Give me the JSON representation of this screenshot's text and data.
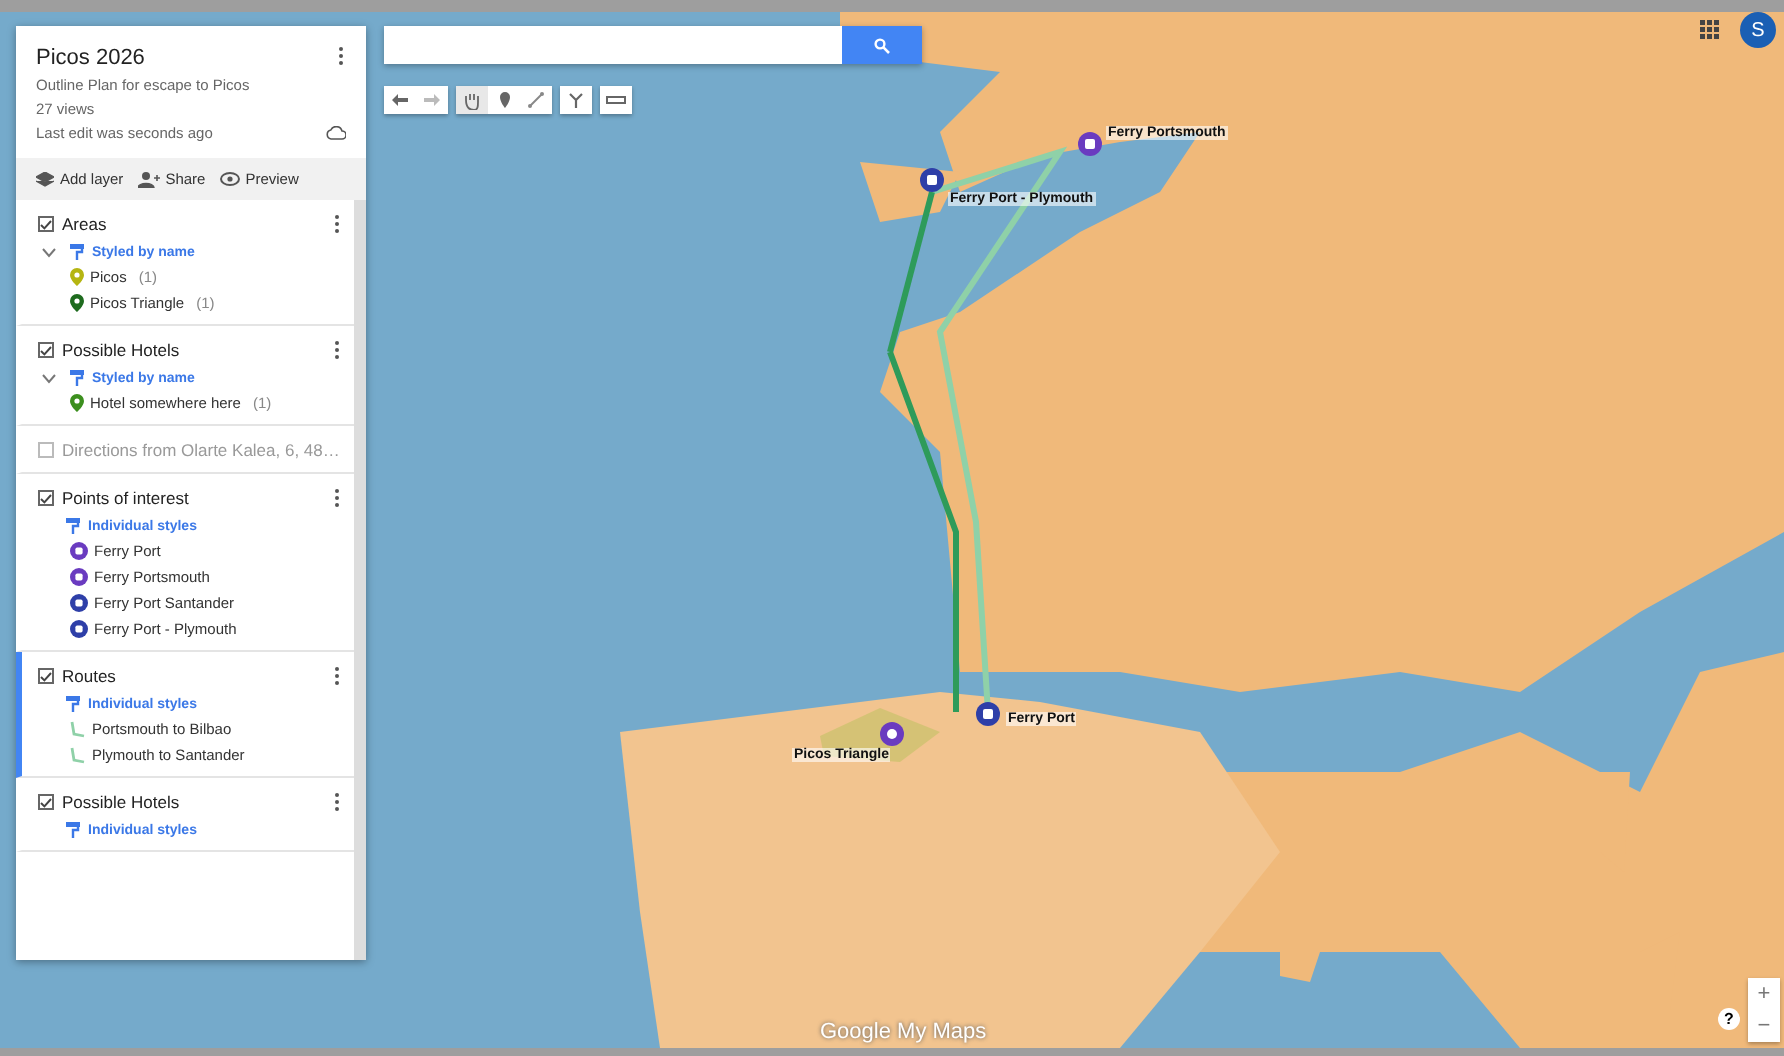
{
  "map_panel": {
    "title": "Picos 2026",
    "description": "Outline Plan for escape to Picos",
    "views": "27 views",
    "last_edit": "Last edit was seconds ago",
    "actions": [
      {
        "kind": "layer",
        "label": "Add layer"
      },
      {
        "kind": "share",
        "label": "Share"
      },
      {
        "kind": "preview",
        "label": "Preview"
      }
    ],
    "layers": [
      {
        "name": "Areas",
        "checked": true,
        "selected": false,
        "style": "Styled by name",
        "collapsible": true,
        "items": [
          {
            "name": "Picos",
            "count": "(1)",
            "kind": "pin",
            "color": "#b5b512"
          },
          {
            "name": "Picos Triangle",
            "count": "(1)",
            "kind": "pin",
            "color": "#1e6b1e"
          }
        ]
      },
      {
        "name": "Possible Hotels",
        "checked": true,
        "selected": false,
        "style": "Styled by name",
        "collapsible": true,
        "items": [
          {
            "name": "Hotel somewhere here",
            "count": "(1)",
            "kind": "pin",
            "color": "#3c8f1e"
          }
        ]
      },
      {
        "name": "Directions from Olarte Kalea, 6, 48…",
        "checked": false,
        "selected": false
      },
      {
        "name": "Points of interest",
        "checked": true,
        "selected": false,
        "style": "Individual styles",
        "collapsible": false,
        "items": [
          {
            "name": "Ferry Port",
            "kind": "ferry",
            "color": "#6a3bc0"
          },
          {
            "name": "Ferry Portsmouth",
            "kind": "ferry",
            "color": "#6a3bc0"
          },
          {
            "name": "Ferry Port Santander",
            "kind": "ferry",
            "color": "#2e3fa8"
          },
          {
            "name": "Ferry Port - Plymouth",
            "kind": "ferry",
            "color": "#2e3fa8"
          }
        ]
      },
      {
        "name": "Routes",
        "checked": true,
        "selected": true,
        "style": "Individual styles",
        "collapsible": false,
        "items": [
          {
            "name": "Portsmouth to Bilbao",
            "kind": "route",
            "color": "#8fd1a8"
          },
          {
            "name": "Plymouth to Santander",
            "kind": "route",
            "color": "#8fd1a8"
          }
        ]
      },
      {
        "name": "Possible Hotels",
        "checked": true,
        "selected": false,
        "style": "Individual styles",
        "collapsible": false
      }
    ]
  },
  "map": {
    "markers": [
      {
        "label": "Ferry Port - Plymouth",
        "kind": "ferry",
        "color": "#2e3fa8"
      },
      {
        "label": "Ferry Portsmouth",
        "kind": "ferry",
        "color": "#6a3bc0"
      },
      {
        "label": "Ferry Port",
        "kind": "ferry",
        "color": "#2e3fa8"
      },
      {
        "label": "Picos Triangle",
        "kind": "area",
        "color": "#6a3bc0"
      }
    ],
    "account_initial": "S",
    "help": "?",
    "zoom_in": "+",
    "zoom_out": "−",
    "logo": "Google My Maps"
  }
}
